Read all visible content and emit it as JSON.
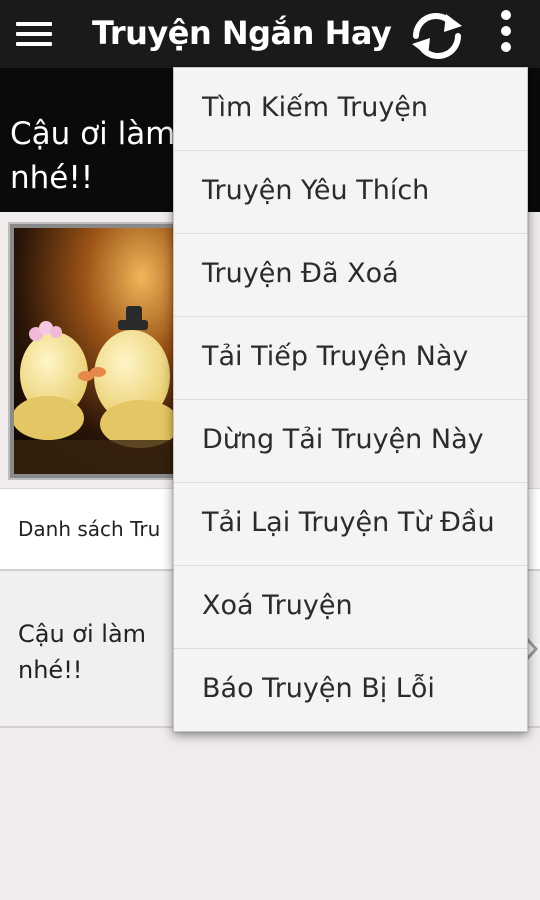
{
  "action_bar": {
    "title": "Truyện Ngắn Hay",
    "menu_icon": "hamburger-menu-icon",
    "refresh_icon": "refresh-icon",
    "overflow_icon": "more-vertical-icon",
    "background_color": "#1a1a1a"
  },
  "story": {
    "title": "Cậu ơi làm nhé!!",
    "title_visible_line1": "Cậu ơi làm",
    "title_visible_line2": "nhé!!",
    "cover_image": "story-cover-image"
  },
  "list": {
    "row1_label": "Danh sách Tru",
    "row2_line1": "Cậu ơi làm",
    "row2_line2": "nhé!!",
    "row2_icon": "chevron-right-icon"
  },
  "menu": {
    "items": [
      {
        "label": "Tìm Kiếm Truyện"
      },
      {
        "label": "Truyện Yêu Thích"
      },
      {
        "label": "Truyện Đã Xoá"
      },
      {
        "label": "Tải Tiếp Truyện Này"
      },
      {
        "label": "Dừng Tải Truyện Này"
      },
      {
        "label": "Tải Lại Truyện Từ Đầu"
      },
      {
        "label": "Xoá Truyện"
      },
      {
        "label": "Báo Truyện Bị Lỗi"
      }
    ]
  }
}
